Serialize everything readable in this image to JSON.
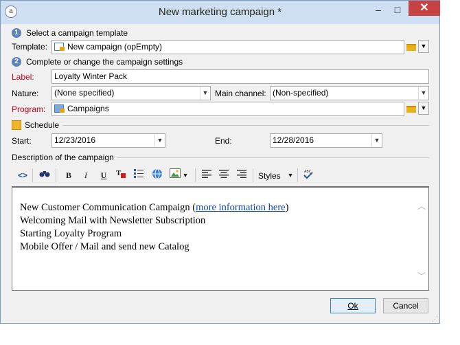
{
  "window": {
    "title": "New marketing campaign *",
    "minimize": "–",
    "maximize": "□",
    "close": "✕"
  },
  "step1": {
    "number": "1",
    "text": "Select a campaign template"
  },
  "template": {
    "label": "Template:",
    "value": "New campaign (opEmpty)"
  },
  "step2": {
    "number": "2",
    "text": "Complete or change the campaign settings"
  },
  "campaign_label": {
    "label": "Label:",
    "value": "Loyalty Winter Pack"
  },
  "nature": {
    "label": "Nature:",
    "value": "(None specified)"
  },
  "main_channel": {
    "label": "Main channel:",
    "value": "(Non-specified)"
  },
  "program": {
    "label": "Program:",
    "value": "Campaigns"
  },
  "schedule": {
    "heading": "Schedule",
    "start_label": "Start:",
    "start_value": "12/23/2016",
    "end_label": "End:",
    "end_value": "12/28/2016"
  },
  "description": {
    "heading": "Description of the campaign",
    "toolbar": {
      "bold": "B",
      "italic": "I",
      "underline": "U",
      "styles": "Styles"
    },
    "lines": [
      "New Customer Communication Campaign (",
      "more information here",
      ")",
      "Welcoming Mail with Newsletter Subscription",
      "Starting Loyalty Program",
      "Mobile Offer / Mail and send new Catalog"
    ]
  },
  "buttons": {
    "ok": "Ok",
    "cancel": "Cancel"
  },
  "colors": {
    "titlebar": "#cfdff2",
    "close": "#c74343",
    "required_label": "#c0001c",
    "link": "#0b40c8",
    "step_badge": "#5c84b8"
  }
}
